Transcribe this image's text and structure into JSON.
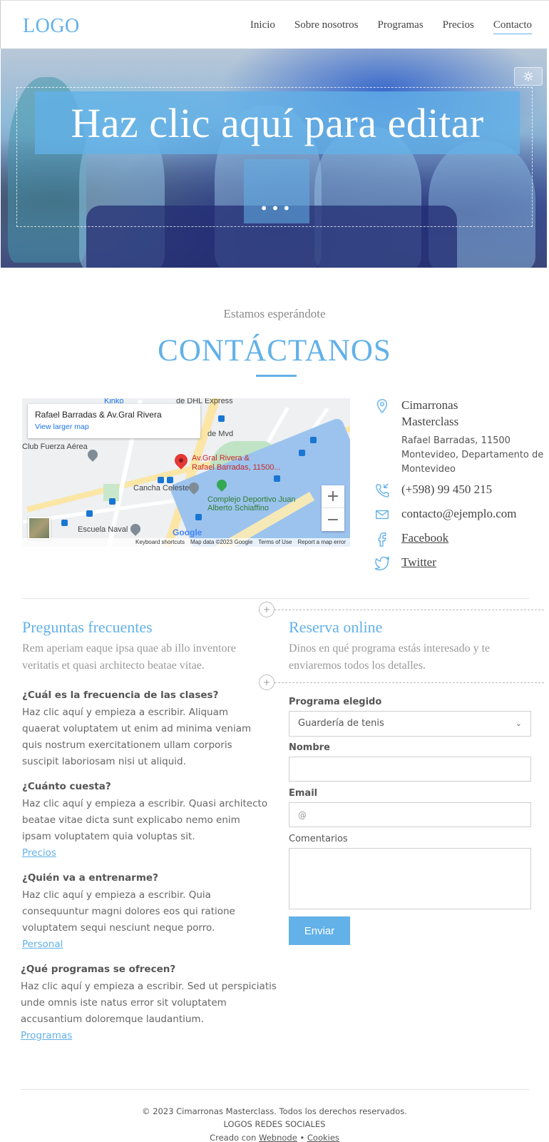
{
  "header": {
    "logo": "LOGO",
    "nav": [
      "Inicio",
      "Sobre nosotros",
      "Programas",
      "Precios",
      "Contacto"
    ]
  },
  "hero": {
    "title": "Haz clic aquí para editar",
    "dots": "•••"
  },
  "section": {
    "kicker": "Estamos esperándote",
    "title": "CONTÁCTANOS"
  },
  "map": {
    "place_name": "Rafael Barradas & Av.Gral Rivera",
    "larger_link": "View larger map",
    "labels": {
      "kinko": "Kinko",
      "dhl": "de DHL Express",
      "club": "Club Fuerza Aérea",
      "cancha": "Cancha Celeste",
      "escuela": "Escuela Naval",
      "complejo": "Complejo Deportivo Juan Alberto Schiaffino",
      "pin_line1": "Av.Gral Rivera &",
      "pin_line2": "Rafael Barradas, 11500...",
      "mvd": "de Mvd"
    },
    "footer": [
      "Keyboard shortcuts",
      "Map data ©2023 Google",
      "Terms of Use",
      "Report a map error"
    ],
    "google": "Google"
  },
  "contact": {
    "name": "Cimarronas Masterclass",
    "address": "Rafael Barradas, 11500 Montevideo, Departamento de Montevideo",
    "phone": "(+598) 99 450 215",
    "email": "contacto@ejemplo.com",
    "facebook": "Facebook",
    "twitter": "Twitter"
  },
  "faq": {
    "title": "Preguntas frecuentes",
    "lede": "Rem aperiam eaque ipsa quae ab illo inventore veritatis et quasi architecto beatae vitae.",
    "items": [
      {
        "q": "¿Cuál es la frecuencia de las clases?",
        "a": "Haz clic aquí y empieza a escribir. Aliquam quaerat voluptatem ut enim ad minima veniam quis nostrum exercitationem ullam corporis suscipit laboriosam nisi ut aliquid.",
        "link": ""
      },
      {
        "q": "¿Cuánto cuesta?",
        "a": "Haz clic aquí y empieza a escribir. Quasi architecto beatae vitae dicta sunt explicabo nemo enim ipsam voluptatem quia voluptas sit.",
        "link": "Precios"
      },
      {
        "q": "¿Quién va a entrenarme?",
        "a": "Haz clic aquí y empieza a escribir. Quia consequuntur magni dolores eos qui ratione voluptatem sequi nesciunt neque porro.",
        "link": "Personal"
      },
      {
        "q": "¿Qué programas se ofrecen?",
        "a": "Haz clic aquí y empieza a escribir. Sed ut perspiciatis unde omnis iste natus error sit voluptatem accusantium doloremque laudantium.",
        "link": "Programas"
      }
    ]
  },
  "booking": {
    "title": "Reserva online",
    "lede": "Dinos en qué programa estás interesado y te enviaremos todos los detalles.",
    "program_label": "Programa elegido",
    "program_value": "Guardería de tenis",
    "name_label": "Nombre",
    "email_label": "Email",
    "email_placeholder": "@",
    "comments_label": "Comentarios",
    "submit": "Enviar"
  },
  "footer": {
    "copyright": "© 2023 Cimarronas Masterclass. Todos los derechos reservados.",
    "social": "LOGOS REDES SOCIALES",
    "created_prefix": "Creado con",
    "webnode": "Webnode",
    "bullet": "•",
    "cookies": "Cookies"
  },
  "colors": {
    "accent": "#62b1e8",
    "text": "#555555",
    "muted": "#999999"
  },
  "icons": {
    "hero_settings": "gear-icon",
    "location": "map-pin-icon",
    "phone": "phone-icon",
    "email": "envelope-icon",
    "facebook": "facebook-icon",
    "twitter": "twitter-icon",
    "select": "chevron-down-icon"
  }
}
